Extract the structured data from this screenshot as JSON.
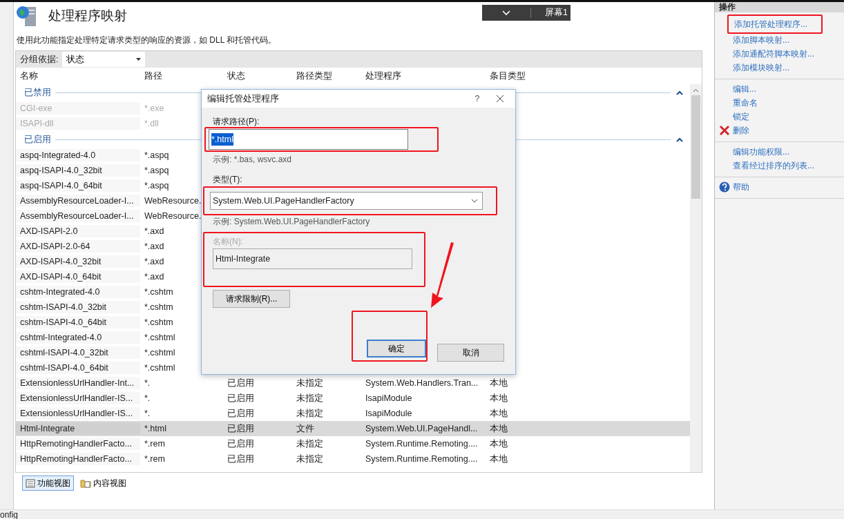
{
  "overlay_toolbar": {
    "label": "屏幕1"
  },
  "page": {
    "title": "处理程序映射",
    "description": "使用此功能指定处理特定请求类型的响应的资源，如 DLL 和托管代码。"
  },
  "group_by": {
    "label": "分组依据:",
    "value": "状态"
  },
  "table": {
    "columns": [
      "名称",
      "路径",
      "状态",
      "路径类型",
      "处理程序",
      "条目类型"
    ],
    "groups": [
      {
        "label": "已禁用",
        "expanded": true,
        "rows": [
          {
            "cells": [
              "CGI-exe",
              "*.exe"
            ],
            "disabled": true,
            "selected": false
          },
          {
            "cells": [
              "ISAPI-dll",
              "*.dll"
            ],
            "disabled": true,
            "selected": false
          }
        ]
      },
      {
        "label": "已启用",
        "expanded": true,
        "rows": [
          {
            "cells": [
              "aspq-Integrated-4.0",
              "*.aspq"
            ],
            "disabled": false,
            "selected": false
          },
          {
            "cells": [
              "aspq-ISAPI-4.0_32bit",
              "*.aspq"
            ],
            "disabled": false,
            "selected": false
          },
          {
            "cells": [
              "aspq-ISAPI-4.0_64bit",
              "*.aspq"
            ],
            "disabled": false,
            "selected": false
          },
          {
            "cells": [
              "AssemblyResourceLoader-I...",
              "WebResource."
            ],
            "disabled": false,
            "selected": false
          },
          {
            "cells": [
              "AssemblyResourceLoader-I...",
              "WebResource."
            ],
            "disabled": false,
            "selected": false
          },
          {
            "cells": [
              "AXD-ISAPI-2.0",
              "*.axd"
            ],
            "disabled": false,
            "selected": false
          },
          {
            "cells": [
              "AXD-ISAPI-2.0-64",
              "*.axd"
            ],
            "disabled": false,
            "selected": false
          },
          {
            "cells": [
              "AXD-ISAPI-4.0_32bit",
              "*.axd"
            ],
            "disabled": false,
            "selected": false
          },
          {
            "cells": [
              "AXD-ISAPI-4.0_64bit",
              "*.axd"
            ],
            "disabled": false,
            "selected": false
          },
          {
            "cells": [
              "cshtm-Integrated-4.0",
              "*.cshtm"
            ],
            "disabled": false,
            "selected": false
          },
          {
            "cells": [
              "cshtm-ISAPI-4.0_32bit",
              "*.cshtm"
            ],
            "disabled": false,
            "selected": false
          },
          {
            "cells": [
              "cshtm-ISAPI-4.0_64bit",
              "*.cshtm"
            ],
            "disabled": false,
            "selected": false
          },
          {
            "cells": [
              "cshtml-Integrated-4.0",
              "*.cshtml"
            ],
            "disabled": false,
            "selected": false
          },
          {
            "cells": [
              "cshtml-ISAPI-4.0_32bit",
              "*.cshtml"
            ],
            "disabled": false,
            "selected": false
          },
          {
            "cells": [
              "cshtml-ISAPI-4.0_64bit",
              "*.cshtml"
            ],
            "disabled": false,
            "selected": false
          },
          {
            "cells": [
              "ExtensionlessUrlHandler-Int...",
              "*.",
              "已启用",
              "未指定",
              "System.Web.Handlers.Tran...",
              "本地"
            ],
            "disabled": false,
            "selected": false
          },
          {
            "cells": [
              "ExtensionlessUrlHandler-IS...",
              "*.",
              "已启用",
              "未指定",
              "IsapiModule",
              "本地"
            ],
            "disabled": false,
            "selected": false
          },
          {
            "cells": [
              "ExtensionlessUrlHandler-IS...",
              "*.",
              "已启用",
              "未指定",
              "IsapiModule",
              "本地"
            ],
            "disabled": false,
            "selected": false
          },
          {
            "cells": [
              "Html-Integrate",
              "*.html",
              "已启用",
              "文件",
              "System.Web.UI.PageHandl...",
              "本地"
            ],
            "disabled": false,
            "selected": true
          },
          {
            "cells": [
              "HttpRemotingHandlerFacto...",
              "*.rem",
              "已启用",
              "未指定",
              "System.Runtime.Remoting....",
              "本地"
            ],
            "disabled": false,
            "selected": false
          },
          {
            "cells": [
              "HttpRemotingHandlerFacto...",
              "*.rem",
              "已启用",
              "未指定",
              "System.Runtime.Remoting....",
              "本地"
            ],
            "disabled": false,
            "selected": false
          }
        ]
      }
    ]
  },
  "view_tabs": [
    {
      "label": "功能视图",
      "selected": true
    },
    {
      "label": "内容视图",
      "selected": false
    }
  ],
  "status_bar": "onfig",
  "actions": {
    "title": "操作",
    "sections": [
      {
        "items": [
          {
            "label": "添加托管处理程序...",
            "kind": "link"
          },
          {
            "label": "添加脚本映射...",
            "kind": "link"
          },
          {
            "label": "添加通配符脚本映射...",
            "kind": "link"
          },
          {
            "label": "添加模块映射...",
            "kind": "link"
          }
        ]
      },
      {
        "items": [
          {
            "label": "编辑...",
            "kind": "link"
          },
          {
            "label": "重命名",
            "kind": "link"
          },
          {
            "label": "锁定",
            "kind": "link"
          },
          {
            "label": "删除",
            "kind": "delete"
          }
        ]
      },
      {
        "items": [
          {
            "label": "编辑功能权限...",
            "kind": "link"
          },
          {
            "label": "查看经过排序的列表...",
            "kind": "link"
          }
        ]
      },
      {
        "items": [
          {
            "label": "帮助",
            "kind": "help"
          }
        ]
      }
    ]
  },
  "dialog": {
    "title": "编辑托管处理程序",
    "help": "?",
    "path": {
      "label": "请求路径(P):",
      "value": "*.html",
      "hint": "示例: *.bas, wsvc.axd"
    },
    "type": {
      "label": "类型(T):",
      "value": "System.Web.UI.PageHandlerFactory",
      "hint": "示例: System.Web.UI.PageHandlerFactory"
    },
    "name": {
      "label": "名称(N):",
      "value": "Html-Integrate",
      "disabled": true
    },
    "restrictions_button": "请求限制(R)...",
    "ok_button": "确定",
    "cancel_button": "取消"
  }
}
